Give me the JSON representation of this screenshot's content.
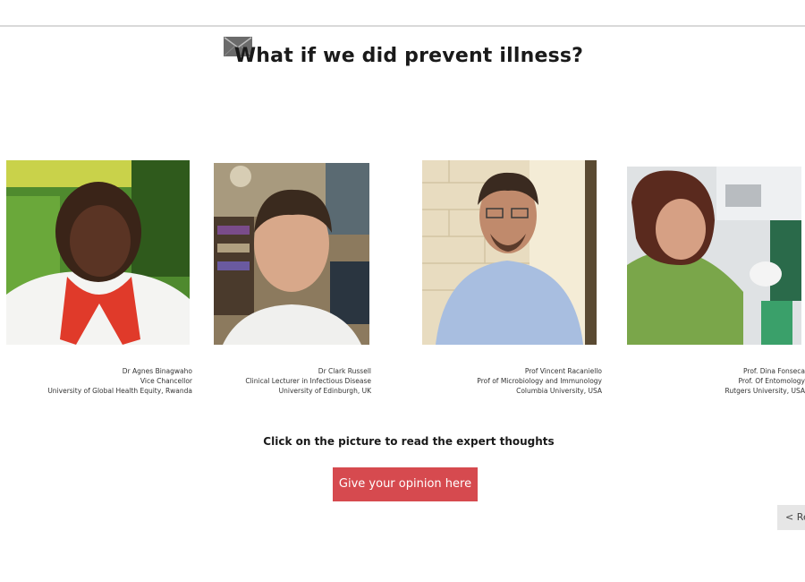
{
  "page": {
    "title": "What if we did prevent illness?",
    "prompt": "Click on the picture to read the expert thoughts",
    "opinion_button": "Give your opinion here",
    "nav_button": "< Re"
  },
  "experts": [
    {
      "name": "Dr Agnes Binagwaho",
      "role": "Vice Chancellor",
      "affiliation": "University of Global Health Equity, Rwanda"
    },
    {
      "name": "Dr Clark  Russell",
      "role": "Clinical Lecturer in Infectious Disease",
      "affiliation": "University of Edinburgh, UK"
    },
    {
      "name": "Prof Vincent Racaniello",
      "role": "Prof of Microbiology and Immunology",
      "affiliation": "Columbia University, USA"
    },
    {
      "name": "Prof. Dina Fonseca",
      "role": "Prof. Of Entomology",
      "affiliation": "Rutgers University, USA"
    }
  ],
  "icons": {
    "header": "envelope-icon"
  },
  "colors": {
    "accent_button": "#d64a4f",
    "nav_button_bg": "#e6e6e6",
    "rule": "#d9d9d9"
  }
}
